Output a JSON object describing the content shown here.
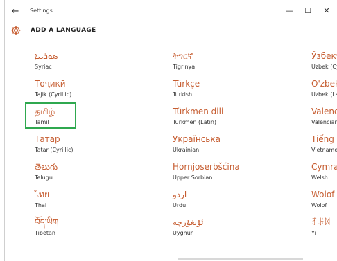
{
  "window": {
    "title": "Settings",
    "back_label": "←",
    "minimize_label": "—",
    "maximize_label": "☐",
    "close_label": "✕"
  },
  "header": {
    "title": "ADD A LANGUAGE",
    "icon": "gear-icon"
  },
  "accent_color": "#c65d31",
  "selection_color": "#2fa84f",
  "selected_language": "Tamil",
  "columns": [
    [
      {
        "native": "ܣܘܪܝܝܐ",
        "english": "Syriac"
      },
      {
        "native": "Тоҷикӣ",
        "english": "Tajik (Cyrillic)"
      },
      {
        "native": "தமிழ்",
        "english": "Tamil"
      },
      {
        "native": "Татар",
        "english": "Tatar (Cyrillic)"
      },
      {
        "native": "తెలుగు",
        "english": "Telugu"
      },
      {
        "native": "ไทย",
        "english": "Thai"
      },
      {
        "native": "བོད་ཡིག",
        "english": "Tibetan"
      }
    ],
    [
      {
        "native": "ትግርኛ",
        "english": "Tigrinya"
      },
      {
        "native": "Türkçe",
        "english": "Turkish"
      },
      {
        "native": "Türkmen dili",
        "english": "Turkmen (Latin)"
      },
      {
        "native": "Українська",
        "english": "Ukrainian"
      },
      {
        "native": "Hornjoserbšćina",
        "english": "Upper Sorbian"
      },
      {
        "native": "اردو",
        "english": "Urdu"
      },
      {
        "native": "ئۇيغۇرچە",
        "english": "Uyghur"
      }
    ],
    [
      {
        "native": "Ўзбекч",
        "english": "Uzbek (Cy"
      },
      {
        "native": "O'zbek",
        "english": "Uzbek (La"
      },
      {
        "native": "Valenc",
        "english": "Valencian"
      },
      {
        "native": "Tiếng V",
        "english": "Vietname"
      },
      {
        "native": "Cymra",
        "english": "Welsh"
      },
      {
        "native": "Wolof",
        "english": "Wolof"
      },
      {
        "native": "ꆈꌠꉙ",
        "english": "Yi"
      }
    ]
  ]
}
